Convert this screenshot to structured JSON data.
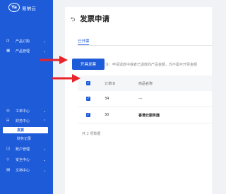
{
  "brand": {
    "logo_mark": "Ya",
    "name": "易纳云"
  },
  "sidebar": {
    "items": [
      {
        "label": "产品订购",
        "icon": "cart-icon",
        "expandable": true
      },
      {
        "label": "产品管理",
        "icon": "box-icon",
        "expandable": true
      },
      {
        "label": "工单中心",
        "icon": "ticket-icon",
        "expandable": true
      },
      {
        "label": "财务中心",
        "icon": "finance-icon",
        "expandable": true,
        "expanded": true
      },
      {
        "label": "账户管理",
        "icon": "account-icon",
        "expandable": true
      },
      {
        "label": "安全中心",
        "icon": "shield-icon",
        "expandable": true
      },
      {
        "label": "文档中心",
        "icon": "doc-icon",
        "expandable": true
      }
    ],
    "finance_sub": [
      {
        "label": "发票",
        "active": true
      },
      {
        "label": "财务记录",
        "active": false
      }
    ]
  },
  "page": {
    "title": "发票申请",
    "tab": "已开票",
    "issue_button": "开具发票",
    "notice": "注：申请退款中或者已退款的产品金额，均不属可开票金额"
  },
  "table": {
    "columns": [
      "订单ID",
      "商品名称"
    ],
    "rows": [
      {
        "order_id": "34",
        "product": "---",
        "checked": true
      },
      {
        "order_id": "30",
        "product": "香港云服务器",
        "checked": true
      }
    ],
    "total": "共 2 项数据"
  },
  "colors": {
    "accent": "#1e5bd8",
    "annotation": "#e8232a"
  }
}
